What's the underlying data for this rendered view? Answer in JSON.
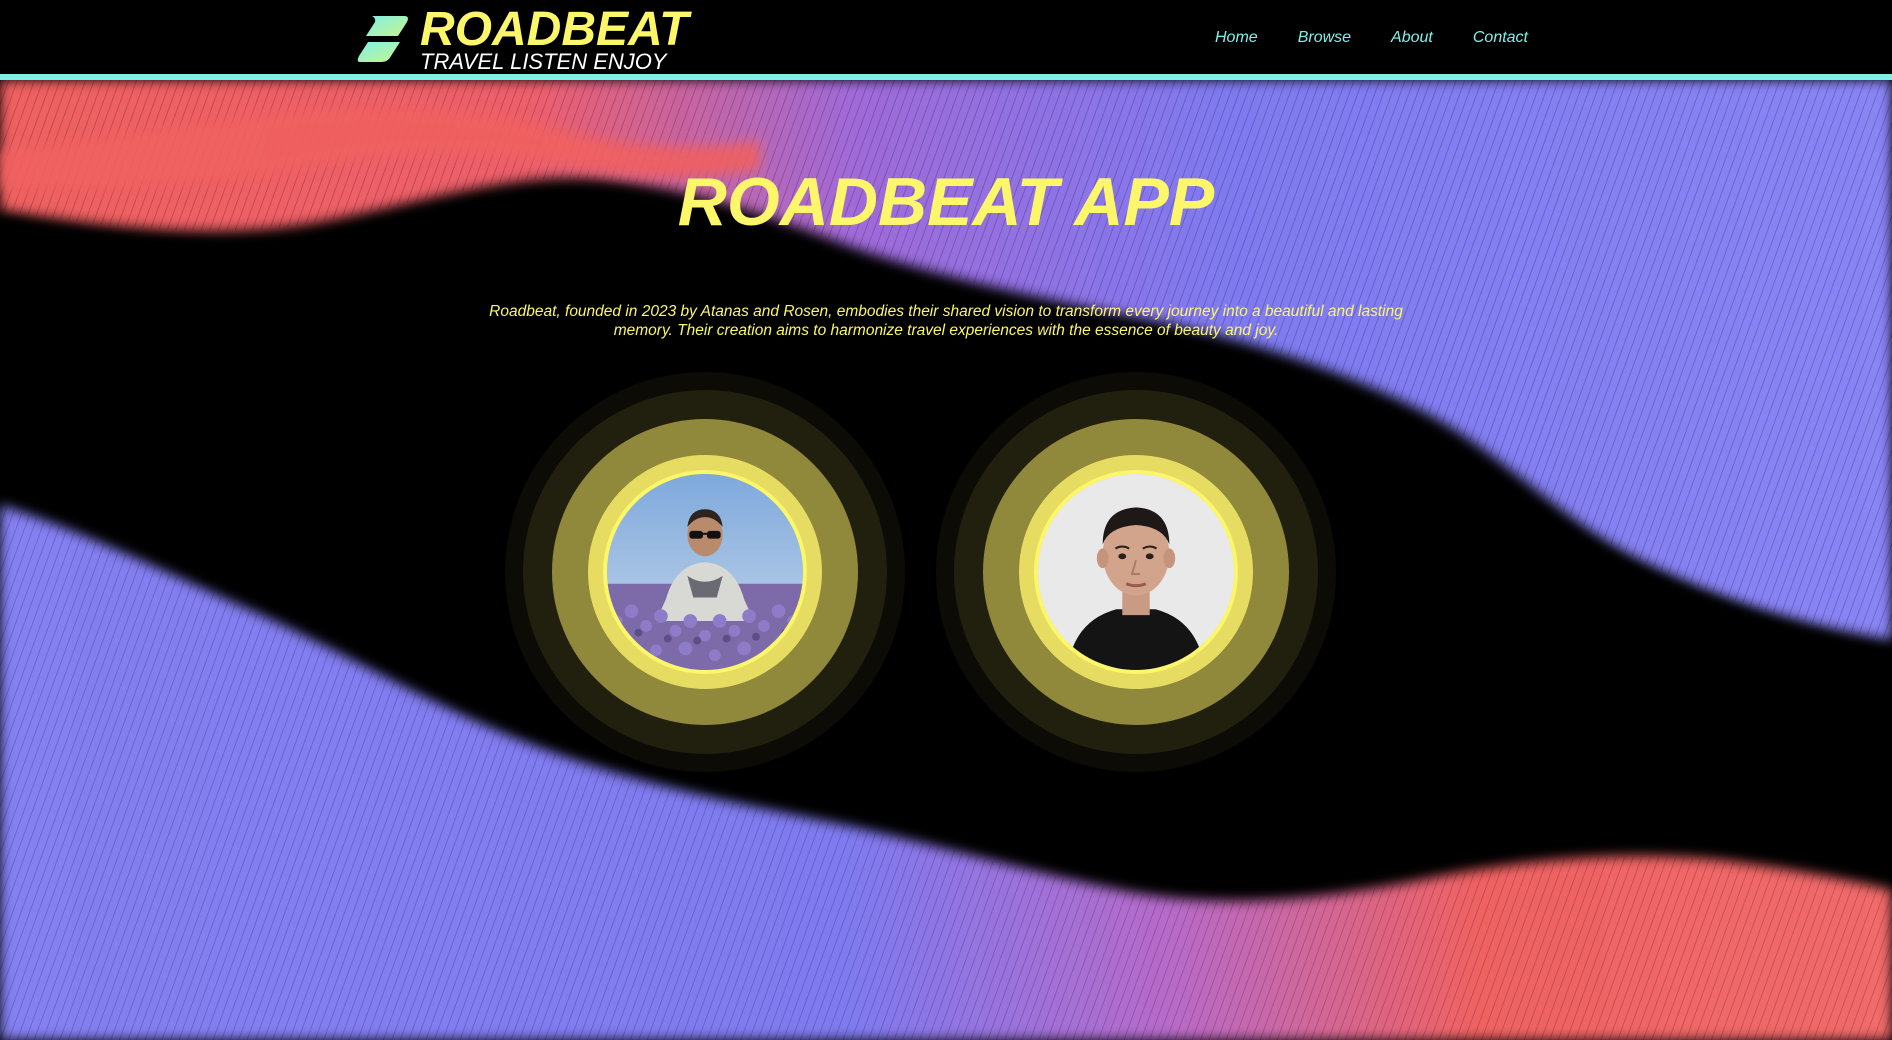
{
  "header": {
    "logo_title": "ROADBEAT",
    "logo_tagline": "TRAVEL LISTEN ENJOY",
    "logo_icon": "roadbeat-logo-icon",
    "nav": [
      {
        "label": "Home"
      },
      {
        "label": "Browse"
      },
      {
        "label": "About"
      },
      {
        "label": "Contact"
      }
    ]
  },
  "main": {
    "title": "ROADBEAT APP",
    "description": "Roadbeat, founded in 2023 by Atanas and Rosen, embodies their shared vision to transform every journey into a beautiful and lasting memory. Their creation aims to harmonize travel experiences with the essence of beauty and joy.",
    "founders": [
      {
        "photo": "founder-photo-lavender-field"
      },
      {
        "photo": "founder-photo-portrait"
      }
    ]
  },
  "colors": {
    "accent_yellow": "#fbf66a",
    "accent_cyan": "#7ef0ea",
    "wave_red": "#f06060",
    "wave_violet": "#7f7af0",
    "background": "#000000"
  }
}
